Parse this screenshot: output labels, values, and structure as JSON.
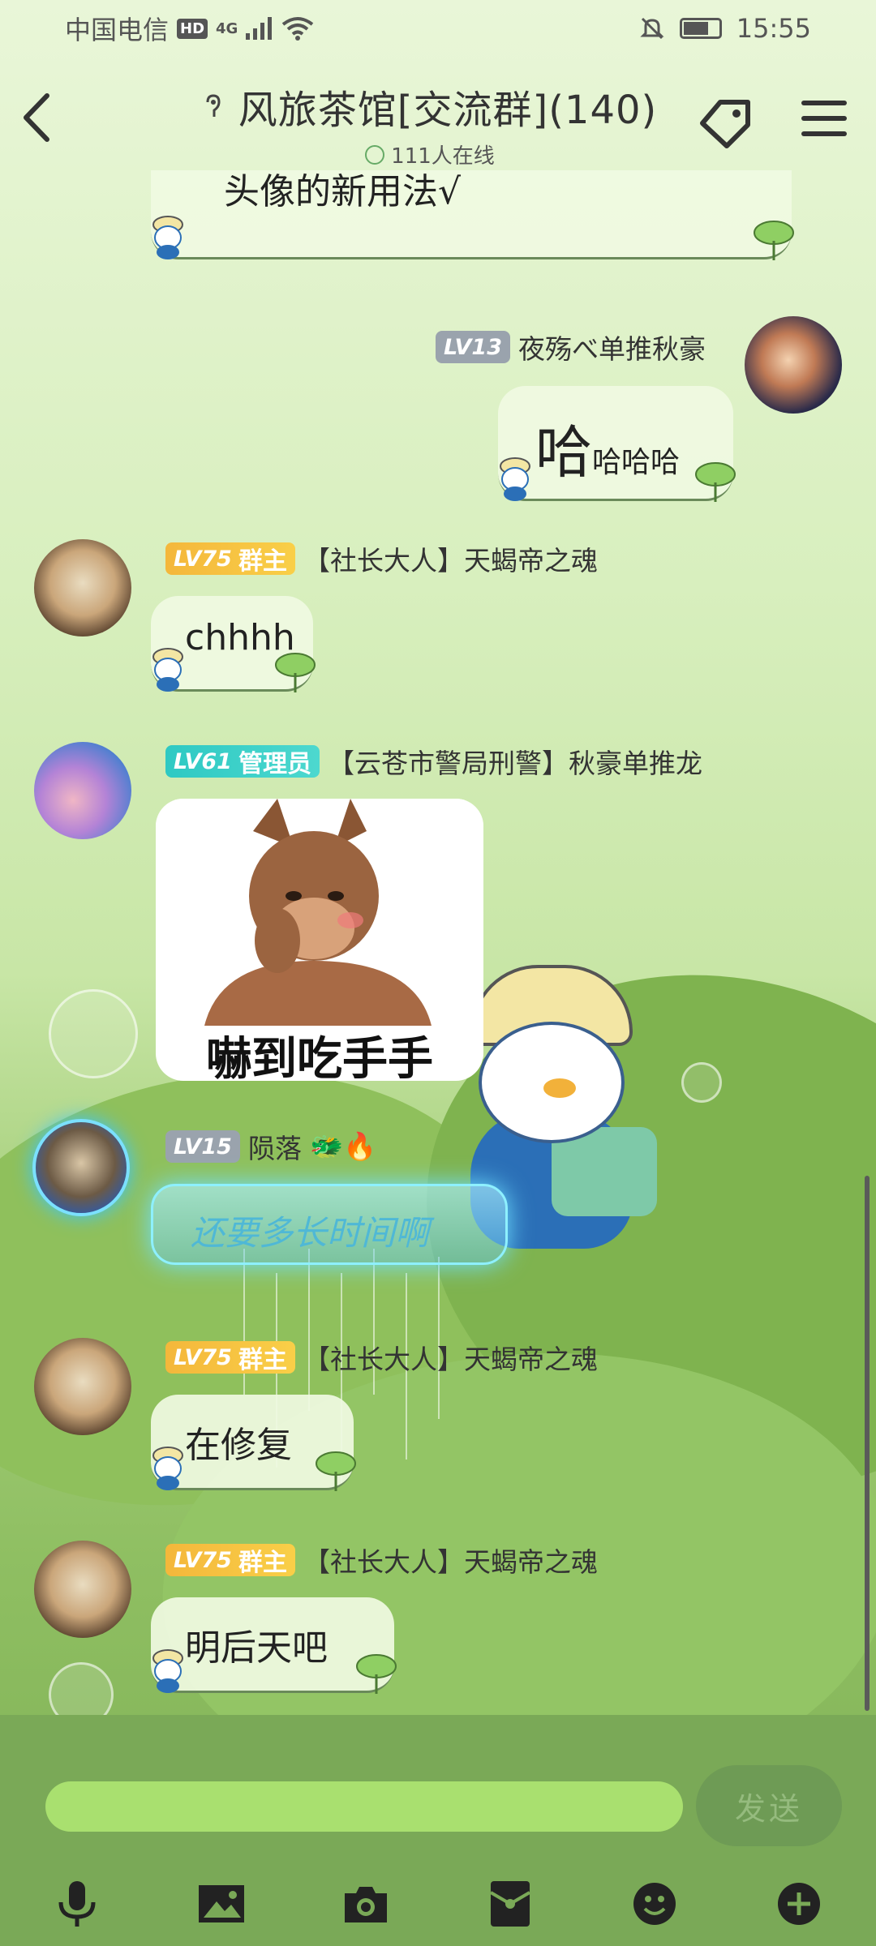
{
  "status_bar": {
    "carrier": "中国电信",
    "hd": "HD",
    "network": "4G",
    "time": "15:55"
  },
  "header": {
    "title": "风旅茶馆[交流群](140)",
    "online": "111人在线",
    "back_icon": "chevron-left-icon",
    "tag_icon": "tag-icon",
    "menu_icon": "menu-icon"
  },
  "messages": [
    {
      "type": "text",
      "side": "left",
      "text": "头像的新用法√",
      "partial": true
    },
    {
      "type": "text",
      "side": "right",
      "level": "LV13",
      "nickname": "夜殇べ单推秋豪",
      "text_big": "哈",
      "text": "哈哈哈"
    },
    {
      "type": "text",
      "side": "left",
      "level": "LV75",
      "role": "群主",
      "nickname": "【社长大人】天蝎帝之魂",
      "text": "chhhh"
    },
    {
      "type": "sticker",
      "side": "left",
      "level": "LV61",
      "role": "管理员",
      "nickname": "【云苍市警局刑警】秋豪单推龙",
      "caption": "嚇到吃手手"
    },
    {
      "type": "text",
      "side": "left",
      "level": "LV15",
      "nickname": "陨落",
      "emojis": "🐲🔥",
      "text": "还要多长时间啊"
    },
    {
      "type": "text",
      "side": "left",
      "level": "LV75",
      "role": "群主",
      "nickname": "【社长大人】天蝎帝之魂",
      "text": "在修复"
    },
    {
      "type": "text",
      "side": "left",
      "level": "LV75",
      "role": "群主",
      "nickname": "【社长大人】天蝎帝之魂",
      "text": "明后天吧"
    }
  ],
  "composer": {
    "input_value": "",
    "send_label": "发送",
    "tools": [
      "microphone-icon",
      "image-icon",
      "camera-icon",
      "red-packet-icon",
      "emoji-icon",
      "plus-icon"
    ]
  },
  "colors": {
    "accent": "#7aa957",
    "input": "#a9e06f",
    "owner_badge": "#f4b73b",
    "admin_badge": "#2ec9c3",
    "level_badge": "#9aa3ad"
  }
}
